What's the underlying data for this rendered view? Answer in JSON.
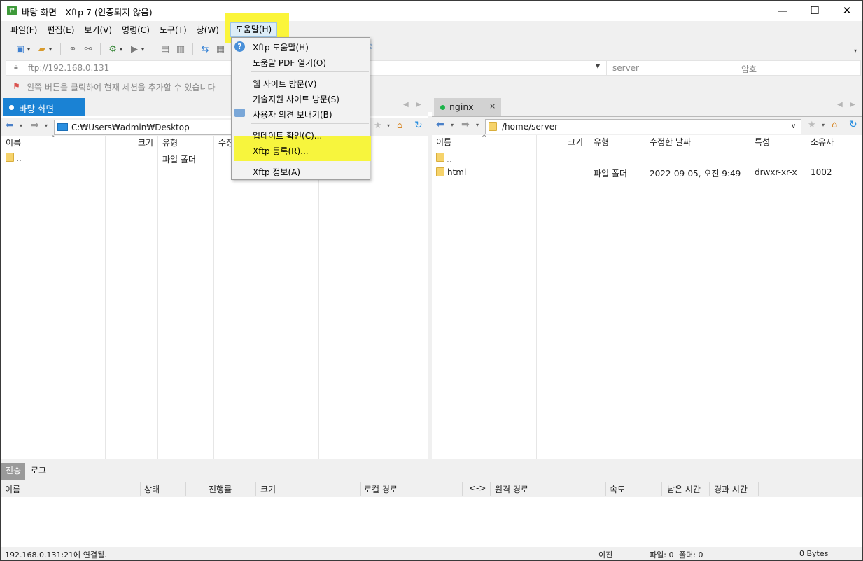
{
  "window": {
    "title": "바탕 화면 - Xftp 7 (인증되지 않음)",
    "minimize": "—",
    "maximize": "☐",
    "close": "✕"
  },
  "menubar": [
    "파일(F)",
    "편집(E)",
    "보기(V)",
    "명령(C)",
    "도구(T)",
    "창(W)",
    "도움말(H)"
  ],
  "address": {
    "url_placeholder": "ftp://192.168.0.131",
    "user_placeholder": "server",
    "password_placeholder": "암호",
    "hint": "왼쪽 버튼을 클릭하여 현재 세션을 추가할 수 있습니다"
  },
  "help_menu": {
    "items": [
      {
        "label": "Xftp 도움말(H)"
      },
      {
        "label": "도움말 PDF 열기(O)"
      },
      {
        "label": "웹 사이트 방문(V)"
      },
      {
        "label": "기술지원 사이트 방문(S)"
      },
      {
        "label": "사용자 의견 보내기(B)"
      },
      {
        "label": "업데이트 확인(C)..."
      },
      {
        "label": "Xftp 등록(R)..."
      },
      {
        "label": "Xftp 정보(A)"
      }
    ]
  },
  "left_pane": {
    "tab": "바탕 화면",
    "path": "C:₩Users₩admin₩Desktop",
    "columns": [
      "이름",
      "크기",
      "유형",
      "수정"
    ],
    "rows": [
      {
        "name": "..",
        "size": "",
        "type": "파일 폴더"
      }
    ]
  },
  "right_pane": {
    "tab": "nginx",
    "tab_close": "×",
    "path": "/home/server",
    "columns": [
      "이름",
      "크기",
      "유형",
      "수정한 날짜",
      "특성",
      "소유자"
    ],
    "rows": [
      {
        "name": "..",
        "size": "",
        "type": "",
        "modified": "",
        "attr": "",
        "owner": ""
      },
      {
        "name": "html",
        "size": "",
        "type": "파일 폴더",
        "modified": "2022-09-05, 오전 9:49",
        "attr": "drwxr-xr-x",
        "owner": "1002"
      }
    ]
  },
  "bottom": {
    "tabs": [
      "전송",
      "로그"
    ],
    "columns": [
      "이름",
      "상태",
      "진행률",
      "크기",
      "로컬 경로",
      "<->",
      "원격 경로",
      "속도",
      "남은 시간",
      "경과 시간"
    ]
  },
  "status": {
    "connection": "192.168.0.131:21에 연결됨.",
    "mode": "이진",
    "files": "파일: 0",
    "folders": "폴더: 0",
    "bytes": "0 Bytes"
  },
  "colors": {
    "accent": "#1a82d4",
    "highlight": "#fbf53a",
    "connected": "#1cb34a",
    "folder": "#f6d36b"
  }
}
